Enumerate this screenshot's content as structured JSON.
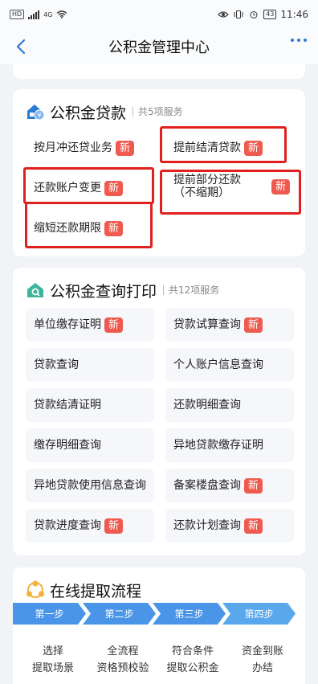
{
  "status_bar": {
    "network": "4G",
    "volte": "HD",
    "battery": "43",
    "time": "11:46"
  },
  "header": {
    "title": "公积金管理中心"
  },
  "loan_card": {
    "title": "公积金贷款",
    "count": "共5项服务",
    "icon": "house-loan-icon",
    "items": [
      {
        "label": "按月冲还贷业务",
        "badge": "新"
      },
      {
        "label": "提前结清贷款",
        "badge": "新"
      },
      {
        "label": "还款账户变更",
        "badge": "新"
      },
      {
        "label": "提前部分还款\n（不缩期）",
        "badge": "新"
      },
      {
        "label": "缩短还款期限",
        "badge": "新"
      }
    ]
  },
  "query_card": {
    "title": "公积金查询打印",
    "count": "共12项服务",
    "icon": "house-search-icon",
    "items": [
      {
        "label": "单位缴存证明",
        "badge": "新"
      },
      {
        "label": "贷款试算查询",
        "badge": "新"
      },
      {
        "label": "贷款查询",
        "badge": ""
      },
      {
        "label": "个人账户信息查询",
        "badge": ""
      },
      {
        "label": "贷款结清证明",
        "badge": ""
      },
      {
        "label": "还款明细查询",
        "badge": ""
      },
      {
        "label": "缴存明细查询",
        "badge": ""
      },
      {
        "label": "异地贷款缴存证明",
        "badge": ""
      },
      {
        "label": "异地贷款使用信息查询",
        "badge": ""
      },
      {
        "label": "备案楼盘查询",
        "badge": "新"
      },
      {
        "label": "贷款进度查询",
        "badge": "新"
      },
      {
        "label": "还款计划查询",
        "badge": "新"
      }
    ]
  },
  "flow_card": {
    "title": "在线提取流程",
    "icon": "people-flow-icon",
    "steps": [
      {
        "label": "第一步",
        "desc": "选择\n提取场景"
      },
      {
        "label": "第二步",
        "desc": "全流程\n资格预校验"
      },
      {
        "label": "第三步",
        "desc": "符合条件\n提取公积金"
      },
      {
        "label": "第四步",
        "desc": "资金到账\n办结"
      }
    ]
  },
  "colors": {
    "accent": "#2b7ad9",
    "badge": "#ef5a4f",
    "highlight": "#e0201c",
    "step": "#4a95e8"
  }
}
